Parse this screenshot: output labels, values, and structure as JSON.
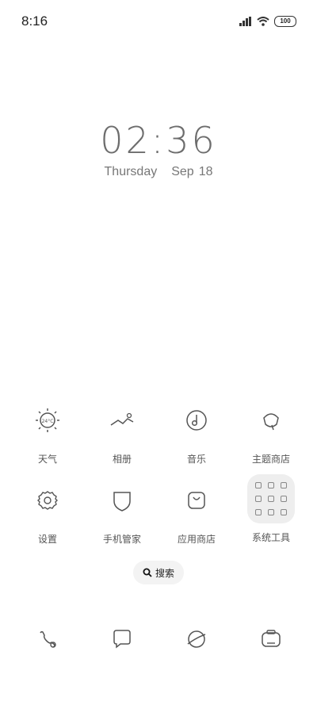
{
  "status": {
    "time": "8:16",
    "battery": "100"
  },
  "clock": {
    "time": "02:36",
    "weekday": "Thursday",
    "month": "Sep",
    "day": "18"
  },
  "apps_row1": [
    {
      "label": "天气",
      "icon": "weather-sun-icon",
      "temp": "24°C"
    },
    {
      "label": "相册",
      "icon": "gallery-icon"
    },
    {
      "label": "音乐",
      "icon": "music-icon"
    },
    {
      "label": "主题商店",
      "icon": "theme-store-icon"
    }
  ],
  "apps_row2": [
    {
      "label": "设置",
      "icon": "gear-icon"
    },
    {
      "label": "手机管家",
      "icon": "shield-icon"
    },
    {
      "label": "应用商店",
      "icon": "app-store-bag-icon"
    },
    {
      "label": "系统工具",
      "icon": "folder-icon"
    }
  ],
  "search": {
    "label": "搜索"
  },
  "dock": [
    {
      "icon": "phone-icon"
    },
    {
      "icon": "messages-icon"
    },
    {
      "icon": "browser-planet-icon"
    },
    {
      "icon": "camera-icon"
    }
  ]
}
